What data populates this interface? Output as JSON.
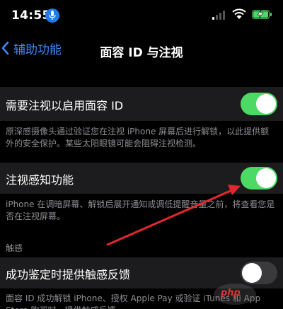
{
  "status_bar": {
    "time": "14:55"
  },
  "nav": {
    "back_label": "辅助功能",
    "title": "面容 ID 与注视"
  },
  "rows": [
    {
      "label": "需要注视以启用面容 ID",
      "toggle": "on",
      "note": "原深感摄像头通过验证您在注视 iPhone 屏幕后进行解锁，以此提供额外的安全保护。某些太阳眼镜可能会阻碍注视检测。"
    },
    {
      "label": "注视感知功能",
      "toggle": "on",
      "note": "iPhone 在调暗屏幕、解锁后展开通知或调低提醒音量之前，将查看您是否在注视屏幕。"
    },
    {
      "section_header": "触感",
      "label": "成功鉴定时提供触感反馈",
      "toggle": "off",
      "note": "面容 ID 成功解锁 iPhone、授权 Apple Pay 或验证 iTunes 和 App Store 购买时，提供触感反馈。"
    }
  ],
  "watermark": "php",
  "colors": {
    "accent": "#3d8bff",
    "toggle_on": "#4cd964",
    "toggle_off": "#3a3a3c",
    "annotation_arrow": "#e0282e"
  },
  "icons": [
    "microphone-icon",
    "cellular-signal-icon",
    "wifi-icon",
    "battery-charging-icon",
    "chevron-left-icon",
    "annotation-arrow"
  ]
}
